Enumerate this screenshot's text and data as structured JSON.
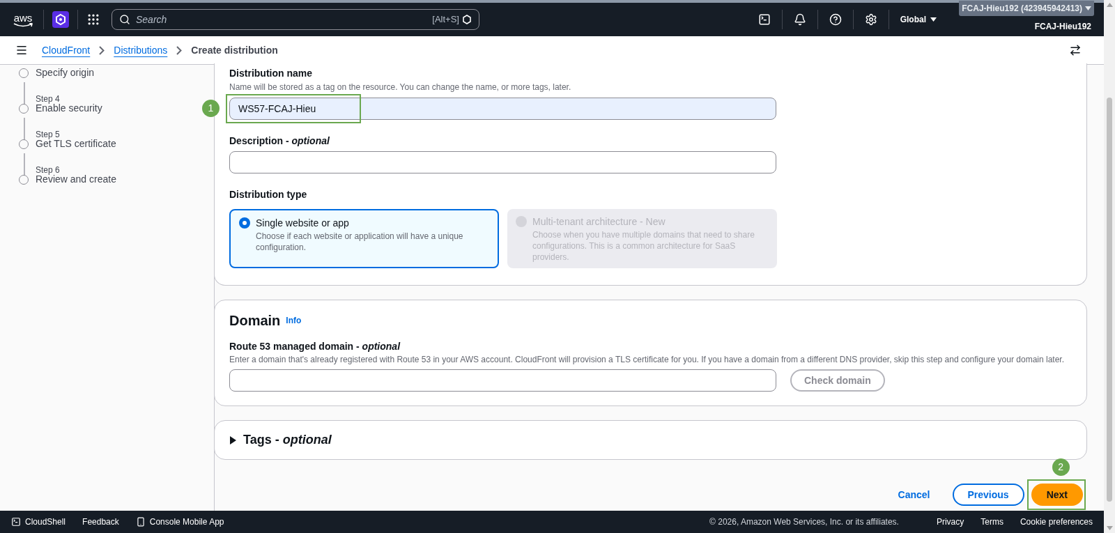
{
  "top_bar": {
    "logo": "aws",
    "search": {
      "placeholder": "Search",
      "shortcut": "[Alt+S]"
    },
    "region": "Global",
    "account": "FCAJ-Hieu192 (423945942413)",
    "user": "FCAJ-Hieu192"
  },
  "breadcrumbs": [
    {
      "label": "CloudFront",
      "link": true
    },
    {
      "label": "Distributions",
      "link": true
    },
    {
      "label": "Create distribution",
      "link": false
    }
  ],
  "steps": [
    {
      "title": "Specify origin"
    },
    {
      "label": "Step 4",
      "title": "Enable security"
    },
    {
      "label": "Step 5",
      "title": "Get TLS certificate"
    },
    {
      "label": "Step 6",
      "title": "Review and create"
    }
  ],
  "settings": {
    "name": {
      "label": "Distribution name",
      "hint": "Name will be stored as a tag on the resource. You can change the name, or more tags, later.",
      "value": "WS57-FCAJ-Hieu"
    },
    "description": {
      "label": "Description - *optional*"
    },
    "type": {
      "label": "Distribution type",
      "options": [
        {
          "title": "Single website or app",
          "text": "Choose if each website or application will have a unique configuration.",
          "selected": true,
          "disabled": false
        },
        {
          "title": "Multi-tenant architecture - New",
          "text": "Choose when you have multiple domains that need to share configurations. This is a common architecture for SaaS providers.",
          "selected": false,
          "disabled": true
        }
      ]
    }
  },
  "domain": {
    "title": "Domain",
    "info": "Info",
    "label": "Route 53 managed domain - *optional*",
    "hint": "Enter a domain that's already registered with Route 53 in your AWS account. CloudFront will provision a TLS certificate for you. If you have a domain from a different DNS provider, skip this step and configure your domain later.",
    "button": "Check domain"
  },
  "tags": {
    "title": "Tags - *optional*",
    "expanded": false
  },
  "actions": [
    {
      "label": "Cancel",
      "kind": "link"
    },
    {
      "label": "Previous",
      "kind": "secondary"
    },
    {
      "label": "Next",
      "kind": "primary"
    }
  ],
  "annotations": [
    {
      "label": "1"
    },
    {
      "label": "2"
    }
  ],
  "footer": {
    "left": [
      {
        "label": "CloudShell",
        "kind": "terminal"
      },
      {
        "label": "Feedback",
        "kind": "plain"
      },
      {
        "label": "Console Mobile App",
        "kind": "phone"
      }
    ],
    "copyright": "© 2026, Amazon Web Services, Inc. or its affiliates.",
    "links": [
      "Privacy",
      "Terms",
      "Cookie preferences"
    ]
  }
}
